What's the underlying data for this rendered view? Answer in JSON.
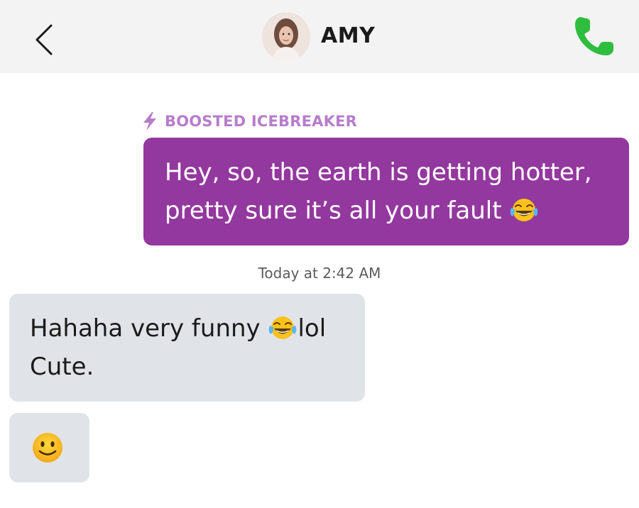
{
  "header": {
    "contact_name": "AMY",
    "back_icon": "chevron-left-icon",
    "call_icon": "phone-icon",
    "call_color": "#2fbd3e"
  },
  "messages": {
    "outgoing": {
      "label": "BOOSTED ICEBREAKER",
      "label_icon": "lightning-bolt-icon",
      "label_color": "#b77dcc",
      "line1": "Hey, so, the earth is getting hotter,",
      "line2": "pretty sure it’s all your fault",
      "emoji": "tears-of-joy-emoji",
      "bubble_color": "#93389e"
    },
    "timestamp": "Today at 2:42 AM",
    "incoming": {
      "line1_part1": "Hahaha very funny",
      "line1_part2": "lol",
      "line2": "Cute.",
      "emoji": "tears-of-joy-emoji",
      "bubble_color": "#e0e4e9"
    },
    "incoming_emoji": {
      "emoji": "slightly-smiling-face-emoji"
    }
  }
}
